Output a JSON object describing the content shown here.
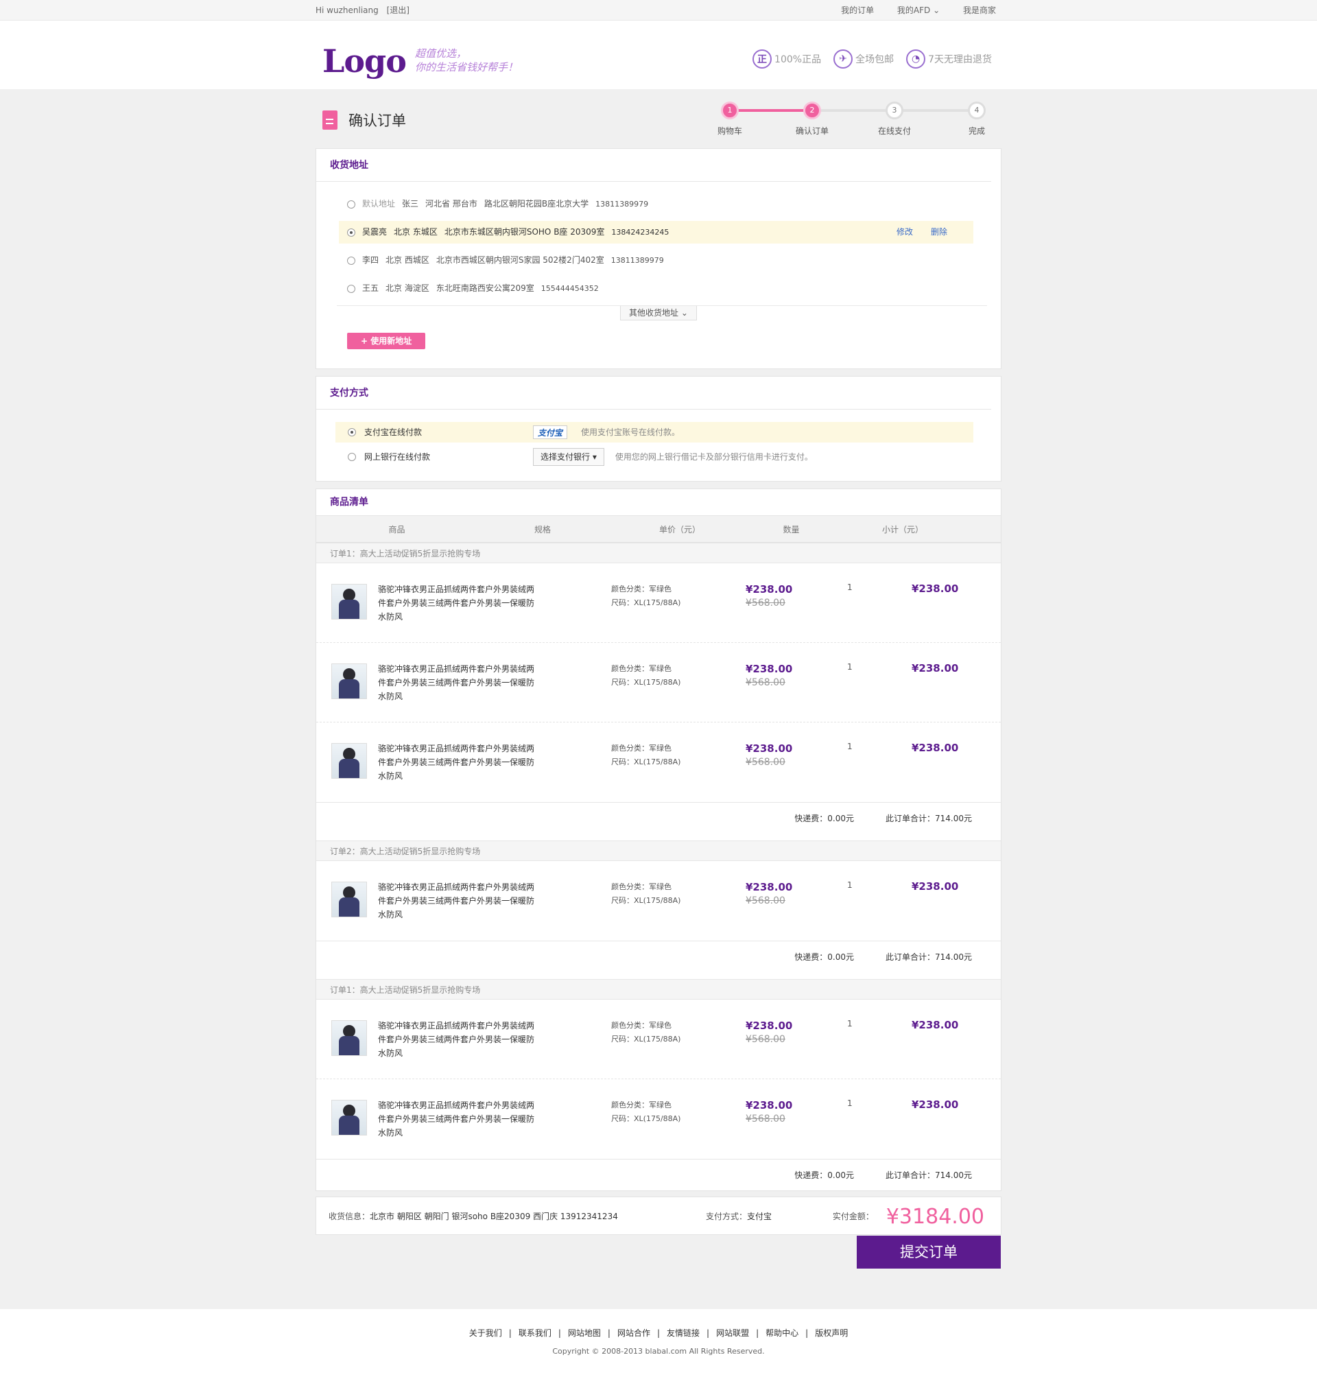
{
  "topbar": {
    "greeting": "Hi wuzhenliang",
    "logout": "[退出]",
    "my_orders": "我的订单",
    "my_afd": "我的AFD",
    "merchant": "我是商家"
  },
  "header": {
    "logo": "Logo",
    "slogan_line1": "超值优选，",
    "slogan_line2": "你的生活省钱好帮手！",
    "badges": [
      {
        "icon": "genuine-icon",
        "glyph": "正",
        "label": "100%正品"
      },
      {
        "icon": "free-shipping-icon",
        "glyph": "✈",
        "label": "全场包邮"
      },
      {
        "icon": "return-clock-icon",
        "glyph": "◔",
        "label": "7天无理由退货"
      }
    ]
  },
  "page": {
    "title": "确认订单",
    "steps": [
      {
        "num": "1",
        "label": "购物车",
        "active": true
      },
      {
        "num": "2",
        "label": "确认订单",
        "active": true
      },
      {
        "num": "3",
        "label": "在线支付",
        "active": false
      },
      {
        "num": "4",
        "label": "完成",
        "active": false
      }
    ]
  },
  "address": {
    "title": "收货地址",
    "items": [
      {
        "default": "默认地址",
        "name": "张三",
        "region": "河北省 邢台市",
        "street": "路北区朝阳花园B座北京大学",
        "phone": "13811389979",
        "selected": false
      },
      {
        "default": "",
        "name": "吴震亮",
        "region": "北京 东城区",
        "street": "北京市东城区朝内银河SOHO B座 20309室",
        "phone": "138424234245",
        "selected": true
      },
      {
        "default": "",
        "name": "李四",
        "region": "北京 西城区",
        "street": "北京市西城区朝内银河S家园 502楼2门402室",
        "phone": "13811389979",
        "selected": false
      },
      {
        "default": "",
        "name": "王五",
        "region": "北京 海淀区",
        "street": "东北旺南路西安公寓209室",
        "phone": "155444454352",
        "selected": false
      }
    ],
    "edit": "修改",
    "delete": "删除",
    "more": "其他收货地址",
    "new_address": "+ 使用新地址"
  },
  "payment": {
    "title": "支付方式",
    "alipay_label": "支付宝在线付款",
    "alipay_logo": "支付宝",
    "alipay_desc": "使用支付宝账号在线付款。",
    "bank_label": "网上银行在线付款",
    "bank_select": "选择支付银行",
    "bank_desc": "使用您的网上银行借记卡及部分银行信用卡进行支付。"
  },
  "goods": {
    "title": "商品清单",
    "columns": [
      "商品",
      "规格",
      "单价（元）",
      "数量",
      "小计（元）"
    ],
    "groups": [
      {
        "title": "订单1：高大上活动促销5折显示抢购专场",
        "items": 3,
        "shipping": "快递费：0.00元",
        "total": "此订单合计：714.00元"
      },
      {
        "title": "订单2：高大上活动促销5折显示抢购专场",
        "items": 1,
        "shipping": "快递费：0.00元",
        "total": "此订单合计：714.00元"
      },
      {
        "title": "订单1：高大上活动促销5折显示抢购专场",
        "items": 2,
        "shipping": "快递费：0.00元",
        "total": "此订单合计：714.00元"
      }
    ],
    "product": {
      "name": "骆驼冲锋衣男正品抓绒两件套户外男装绒两件套户外男装三绒两件套户外男装一保暖防水防风",
      "color": "颜色分类：军绿色",
      "size": "尺码：XL(175/88A)",
      "price": "¥238.00",
      "old_price": "¥568.00",
      "qty": "1",
      "subtotal": "¥238.00"
    }
  },
  "summary": {
    "info_label": "收货信息：",
    "info_value": "北京市 朝阳区 朝阳门 银河soho B座20309 西门庆 13912341234",
    "pay_label": "支付方式：",
    "pay_value": "支付宝",
    "amount_label": "实付金额：",
    "amount": "¥3184.00",
    "submit": "提交订单"
  },
  "footer": {
    "links": [
      "关于我们",
      "联系我们",
      "网站地图",
      "网站合作",
      "友情链接",
      "网站联盟",
      "帮助中心",
      "版权声明"
    ],
    "copyright": "Copyright © 2008-2013 blabal.com All Rights Reserved."
  }
}
